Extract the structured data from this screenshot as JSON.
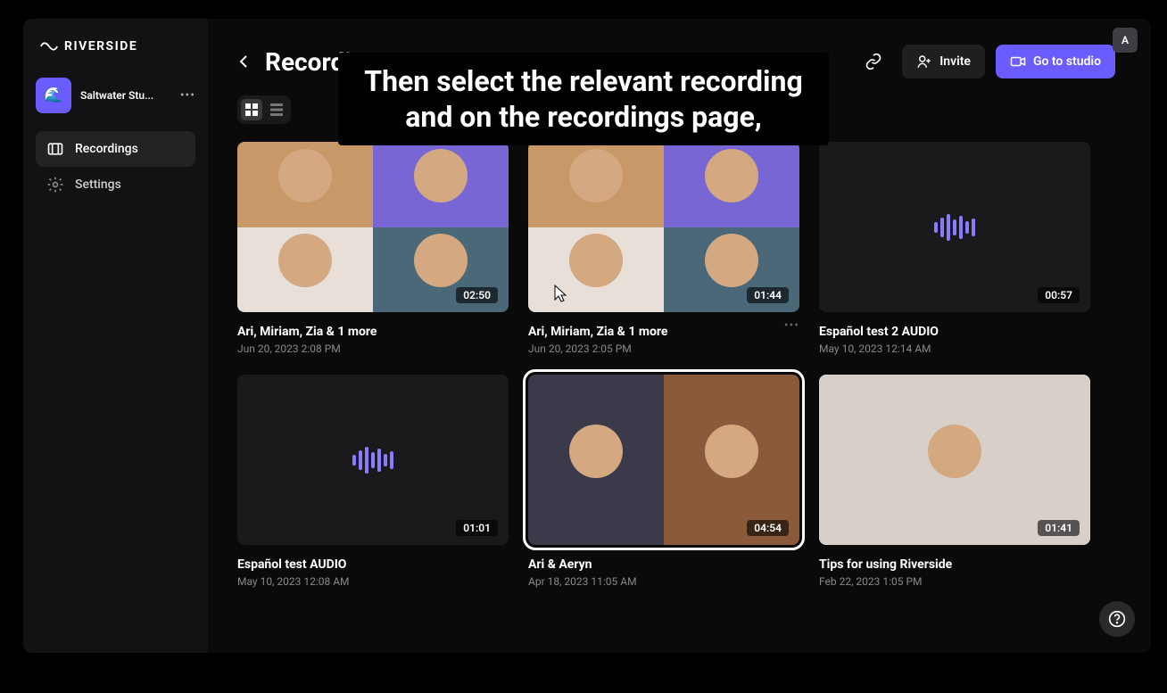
{
  "brand": "RIVERSIDE",
  "studio": {
    "icon": "🌊",
    "name": "Saltwater Stu..."
  },
  "sidebar": {
    "recordings": "Recordings",
    "settings": "Settings"
  },
  "header": {
    "title": "Recordings",
    "invite": "Invite",
    "go_to_studio": "Go to studio"
  },
  "caption": "Then select the relevant recording and on the recordings page,",
  "user_initial": "A",
  "recordings": [
    {
      "title": "Ari, Miriam, Zia & 1 more",
      "date": "Jun 20, 2023 2:08 PM",
      "duration": "02:50",
      "type": "video4"
    },
    {
      "title": "Ari, Miriam, Zia & 1 more",
      "date": "Jun 20, 2023 2:05 PM",
      "duration": "01:44",
      "type": "video4",
      "more": true
    },
    {
      "title": "Español test 2 AUDIO",
      "date": "May 10, 2023 12:14 AM",
      "duration": "00:57",
      "type": "audio"
    },
    {
      "title": "Español test AUDIO",
      "date": "May 10, 2023 12:08 AM",
      "duration": "01:01",
      "type": "audio"
    },
    {
      "title": "Ari & Aeryn",
      "date": "Apr 18, 2023 11:05 AM",
      "duration": "04:54",
      "type": "video2",
      "highlighted": true
    },
    {
      "title": "Tips for using Riverside",
      "date": "Feb 22, 2023 1:05 PM",
      "duration": "01:41",
      "type": "video1"
    }
  ]
}
